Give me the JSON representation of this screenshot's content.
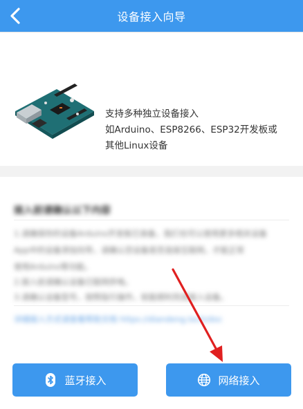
{
  "header": {
    "title": "设备接入向导",
    "back_icon": "chevron-left-icon"
  },
  "device": {
    "image_icon": "arduino-board-icon",
    "desc_lines": [
      "支持多种独立设备接入",
      "如Arduino、ESP8266、ESP32开发板或",
      "其他Linux设备"
    ]
  },
  "info": {
    "title": "接入前请确认以下内容",
    "lines": [
      "1.请确保你的设备Arduino开发板已准备，我们也可以使用更多相关设备",
      "App中的设备添加向导，请确认您设备是否连接互联网，才能正常",
      "使用Arduino等功能。",
      "2.接入前请确认设备已联网供电。",
      "3.请确认设备型号，按照指引操作，就能顺利完成接入设备。",
      "详细接入方式请查看帮助文档 https://diandeng.tech/doc"
    ]
  },
  "buttons": {
    "bluetooth": {
      "label": "蓝牙接入",
      "icon": "bluetooth-icon"
    },
    "network": {
      "label": "网络接入",
      "icon": "globe-icon"
    }
  },
  "colors": {
    "primary": "#3d98ee",
    "annotation_arrow": "#e02020"
  }
}
